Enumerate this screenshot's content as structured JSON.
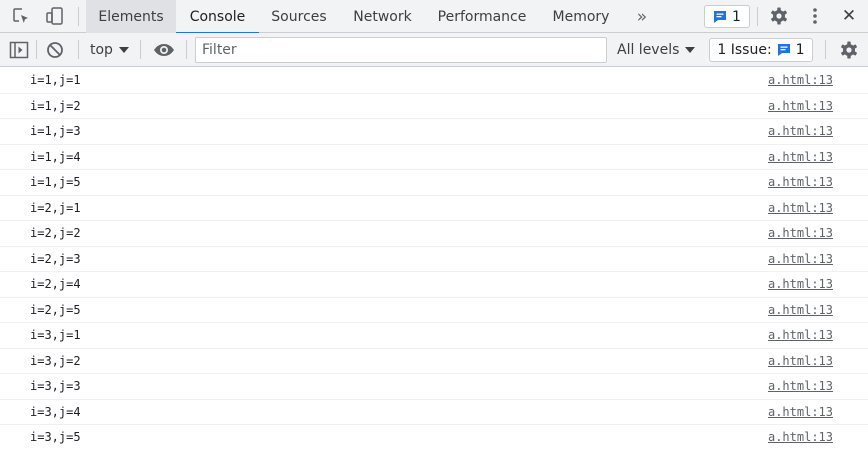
{
  "devtools": {
    "tabs": [
      {
        "label": "Elements"
      },
      {
        "label": "Console"
      },
      {
        "label": "Sources"
      },
      {
        "label": "Network"
      },
      {
        "label": "Performance"
      },
      {
        "label": "Memory"
      }
    ],
    "more_tabs": "»",
    "message_count": "1",
    "close_symbol": "✕"
  },
  "toolbar": {
    "context": "top",
    "filter_placeholder": "Filter",
    "levels": "All levels",
    "issues_label": "1 Issue:",
    "issues_count": "1"
  },
  "console": {
    "messages": [
      {
        "text": "i=1,j=1",
        "source": "a.html:13"
      },
      {
        "text": "i=1,j=2",
        "source": "a.html:13"
      },
      {
        "text": "i=1,j=3",
        "source": "a.html:13"
      },
      {
        "text": "i=1,j=4",
        "source": "a.html:13"
      },
      {
        "text": "i=1,j=5",
        "source": "a.html:13"
      },
      {
        "text": "i=2,j=1",
        "source": "a.html:13"
      },
      {
        "text": "i=2,j=2",
        "source": "a.html:13"
      },
      {
        "text": "i=2,j=3",
        "source": "a.html:13"
      },
      {
        "text": "i=2,j=4",
        "source": "a.html:13"
      },
      {
        "text": "i=2,j=5",
        "source": "a.html:13"
      },
      {
        "text": "i=3,j=1",
        "source": "a.html:13"
      },
      {
        "text": "i=3,j=2",
        "source": "a.html:13"
      },
      {
        "text": "i=3,j=3",
        "source": "a.html:13"
      },
      {
        "text": "i=3,j=4",
        "source": "a.html:13"
      },
      {
        "text": "i=3,j=5",
        "source": "a.html:13"
      }
    ]
  },
  "colors": {
    "accent": "#1a73e8",
    "toolbar_bg": "#f1f3f4",
    "border": "#cbcdd1"
  }
}
